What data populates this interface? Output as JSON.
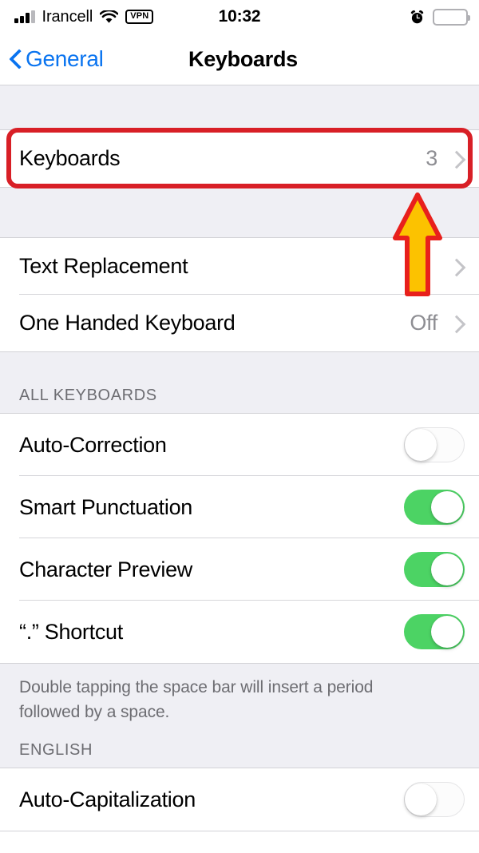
{
  "status_bar": {
    "carrier": "Irancell",
    "signal_bars_filled": 3,
    "signal_bars_total": 4,
    "wifi_icon": "wifi-icon",
    "vpn_badge": "VPN",
    "time": "10:32",
    "alarm_icon": "alarm-clock-icon",
    "battery_level_percent": 14,
    "battery_color": "#f2392c"
  },
  "nav_bar": {
    "back_label": "General",
    "back_icon": "chevron-left-icon",
    "title": "Keyboards",
    "accent_color": "#0a74f0"
  },
  "sections": {
    "keyboards": {
      "rows": [
        {
          "label": "Keyboards",
          "value": "3",
          "accessory": "chevron-right-icon"
        }
      ]
    },
    "text_tools": {
      "rows": [
        {
          "label": "Text Replacement",
          "value": "",
          "accessory": "chevron-right-icon"
        },
        {
          "label": "One Handed Keyboard",
          "value": "Off",
          "accessory": "chevron-right-icon"
        }
      ]
    },
    "all_keyboards": {
      "header": "ALL KEYBOARDS",
      "rows": [
        {
          "label": "Auto-Correction",
          "toggle": "off"
        },
        {
          "label": "Smart Punctuation",
          "toggle": "on"
        },
        {
          "label": "Character Preview",
          "toggle": "on"
        },
        {
          "label": "“.” Shortcut",
          "toggle": "on"
        }
      ],
      "footer": "Double tapping the space bar will insert a period followed by a space."
    },
    "english": {
      "header": "ENGLISH",
      "rows": [
        {
          "label": "Auto-Capitalization",
          "toggle": "off"
        }
      ]
    }
  },
  "annotations": {
    "highlight_box": {
      "target": "Keyboards",
      "color": "#d81f26"
    },
    "arrow": {
      "direction": "up",
      "fill_color": "#fcc200",
      "stroke_color": "#e8201c"
    }
  },
  "toggle_on_color": "#4cd364"
}
